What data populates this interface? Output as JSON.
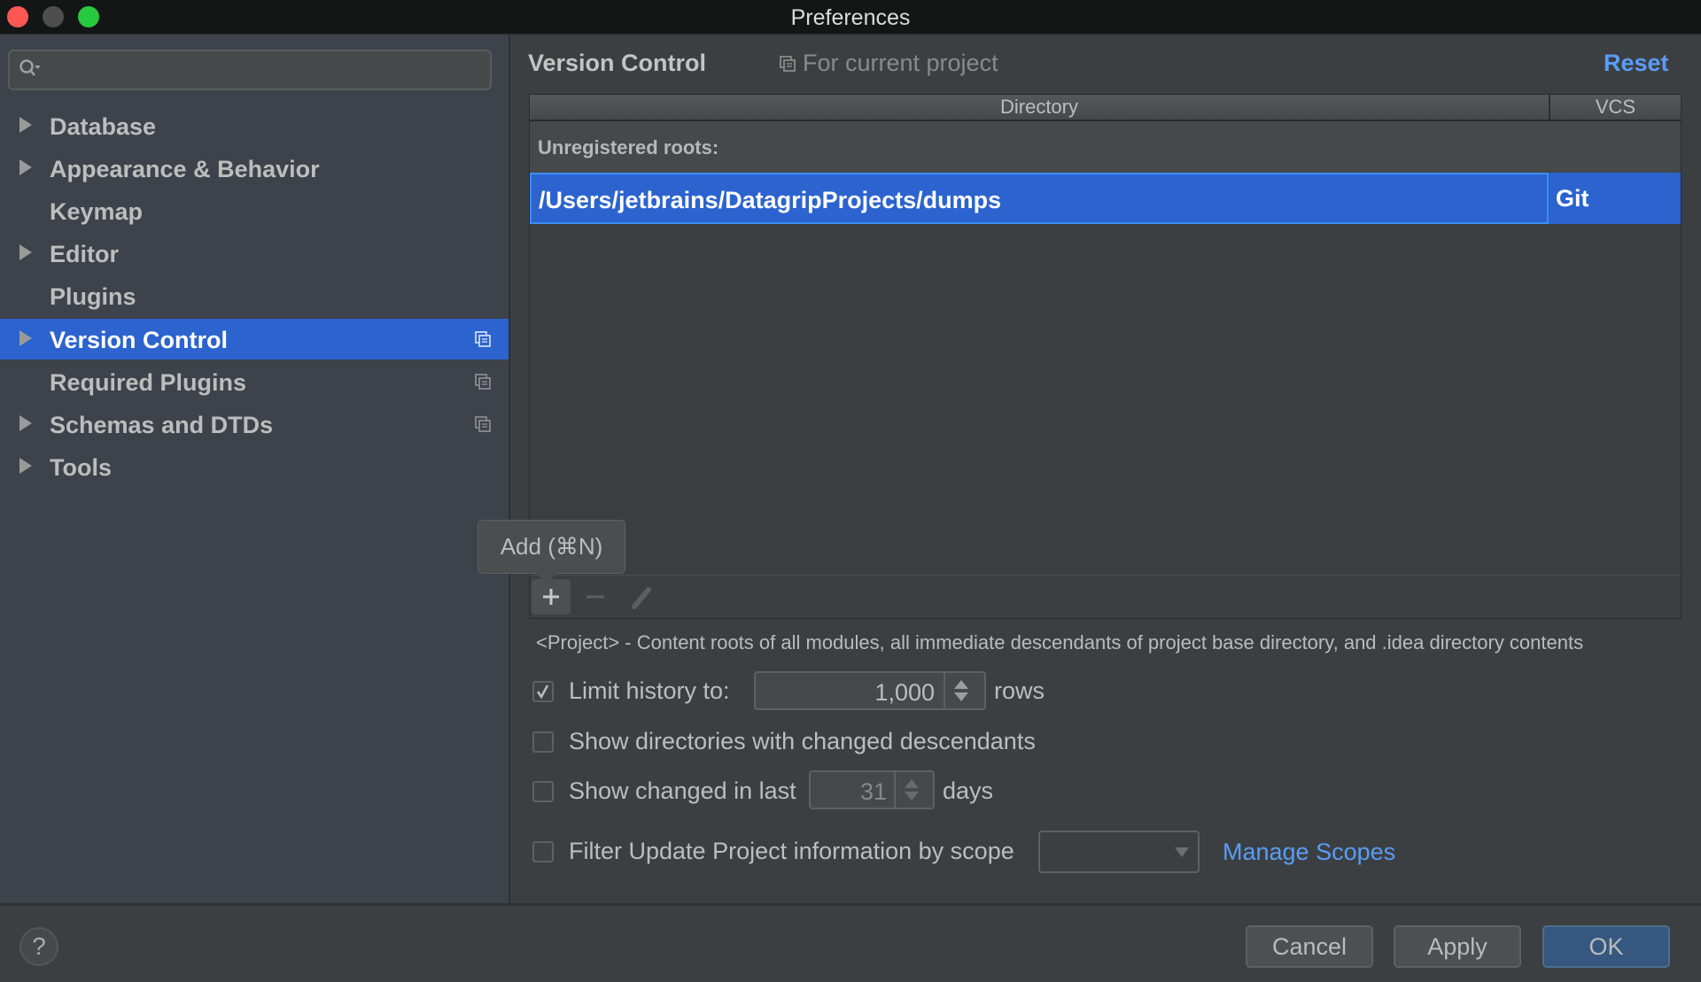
{
  "window": {
    "title": "Preferences"
  },
  "sidebar": {
    "search_placeholder": "",
    "items": [
      {
        "label": "Database",
        "expandable": true,
        "project_scoped": false
      },
      {
        "label": "Appearance & Behavior",
        "expandable": true,
        "project_scoped": false
      },
      {
        "label": "Keymap",
        "expandable": false,
        "project_scoped": false
      },
      {
        "label": "Editor",
        "expandable": true,
        "project_scoped": false
      },
      {
        "label": "Plugins",
        "expandable": false,
        "project_scoped": false
      },
      {
        "label": "Version Control",
        "expandable": true,
        "project_scoped": true,
        "selected": true
      },
      {
        "label": "Required Plugins",
        "expandable": false,
        "project_scoped": true
      },
      {
        "label": "Schemas and DTDs",
        "expandable": true,
        "project_scoped": true
      },
      {
        "label": "Tools",
        "expandable": true,
        "project_scoped": false
      }
    ]
  },
  "main": {
    "title": "Version Control",
    "scope_label": "For current project",
    "reset_label": "Reset",
    "table": {
      "columns": [
        "Directory",
        "VCS"
      ],
      "group_label": "Unregistered roots:",
      "rows": [
        {
          "directory": "/Users/jetbrains/DatagripProjects/dumps",
          "vcs": "Git",
          "selected": true
        }
      ]
    },
    "toolbar": {
      "add_tooltip": "Add (⌘N)"
    },
    "description": "<Project> - Content roots of all modules, all immediate descendants of project base directory, and .idea directory contents",
    "options": {
      "limit_history": {
        "label": "Limit history to:",
        "checked": true,
        "value": "1,000",
        "suffix": "rows"
      },
      "show_dirs": {
        "label": "Show directories with changed descendants",
        "checked": false
      },
      "show_changed": {
        "label": "Show changed in last",
        "checked": false,
        "value": "31",
        "suffix": "days"
      },
      "filter_scope": {
        "label": "Filter Update Project information by scope",
        "checked": false,
        "selected": ""
      },
      "manage_scopes": "Manage Scopes"
    }
  },
  "footer": {
    "help": "?",
    "cancel": "Cancel",
    "apply": "Apply",
    "ok": "OK"
  },
  "colors": {
    "accent": "#2c63cf",
    "link": "#589df6",
    "primary_button": "#365880"
  }
}
